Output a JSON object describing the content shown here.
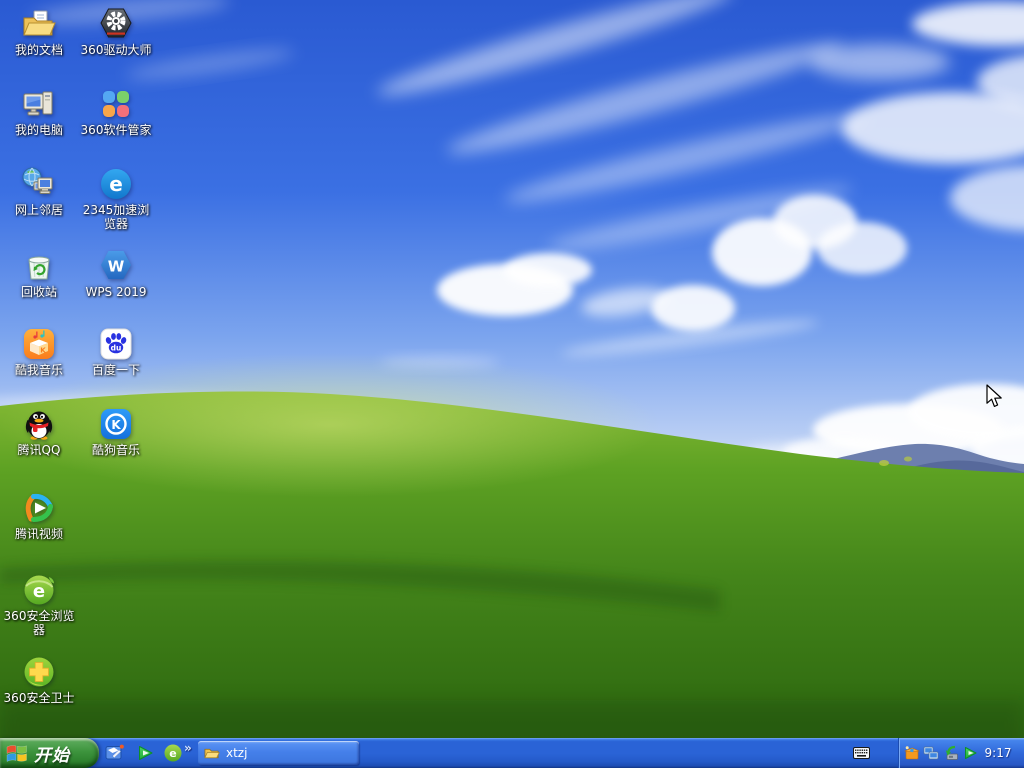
{
  "wallpaper": {
    "name": "Bliss",
    "sky_color": "#2a5ad2",
    "grass_color": "#4e9120"
  },
  "desktop": {
    "icons": [
      {
        "label": "我的文档"
      },
      {
        "label": "360驱动大师"
      },
      {
        "label": "我的电脑"
      },
      {
        "label": "360软件管家"
      },
      {
        "label": "网上邻居"
      },
      {
        "label": "2345加速浏览器"
      },
      {
        "label": "回收站"
      },
      {
        "label": "WPS 2019"
      },
      {
        "label": "酷我音乐"
      },
      {
        "label": "百度一下"
      },
      {
        "label": "腾讯QQ"
      },
      {
        "label": "酷狗音乐"
      },
      {
        "label": "腾讯视频"
      },
      {
        "label": "360安全浏览器"
      },
      {
        "label": "360安全卫士"
      }
    ]
  },
  "icon_glyphs": {
    "e2345": "e",
    "wps": "W",
    "kuwo": "K",
    "baidu": "du",
    "kugou": "K",
    "secure_e": "e",
    "quick_e": "e"
  },
  "taskbar": {
    "start": {
      "label": "开始"
    },
    "quick_launch": {
      "items": [
        "show-desktop",
        "media-play",
        "360-secure-browser"
      ],
      "overflow_chevron": "»"
    },
    "task_buttons": [
      {
        "label": "xtzj"
      }
    ],
    "tray": {
      "icons": [
        "360-software-box",
        "network-status",
        "safely-remove-hardware",
        "media-play"
      ],
      "clock": "9:17"
    }
  }
}
